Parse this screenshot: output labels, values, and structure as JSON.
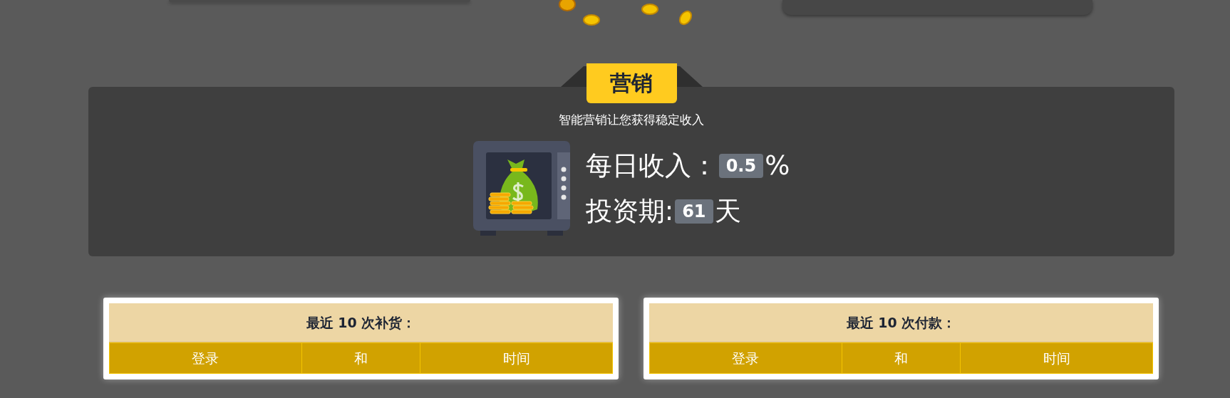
{
  "marketing": {
    "title": "营销",
    "subtitle": "智能营销让您获得稳定收入",
    "stats": [
      {
        "label": "每日收入：",
        "value": "0.5",
        "unit": "%"
      },
      {
        "label": "投资期:",
        "value": "61",
        "unit": "天"
      }
    ]
  },
  "tables": [
    {
      "title": "最近 10 次补货：",
      "columns": [
        "登录",
        "和",
        "时间"
      ]
    },
    {
      "title": "最近 10 次付款：",
      "columns": [
        "登录",
        "和",
        "时间"
      ]
    }
  ]
}
